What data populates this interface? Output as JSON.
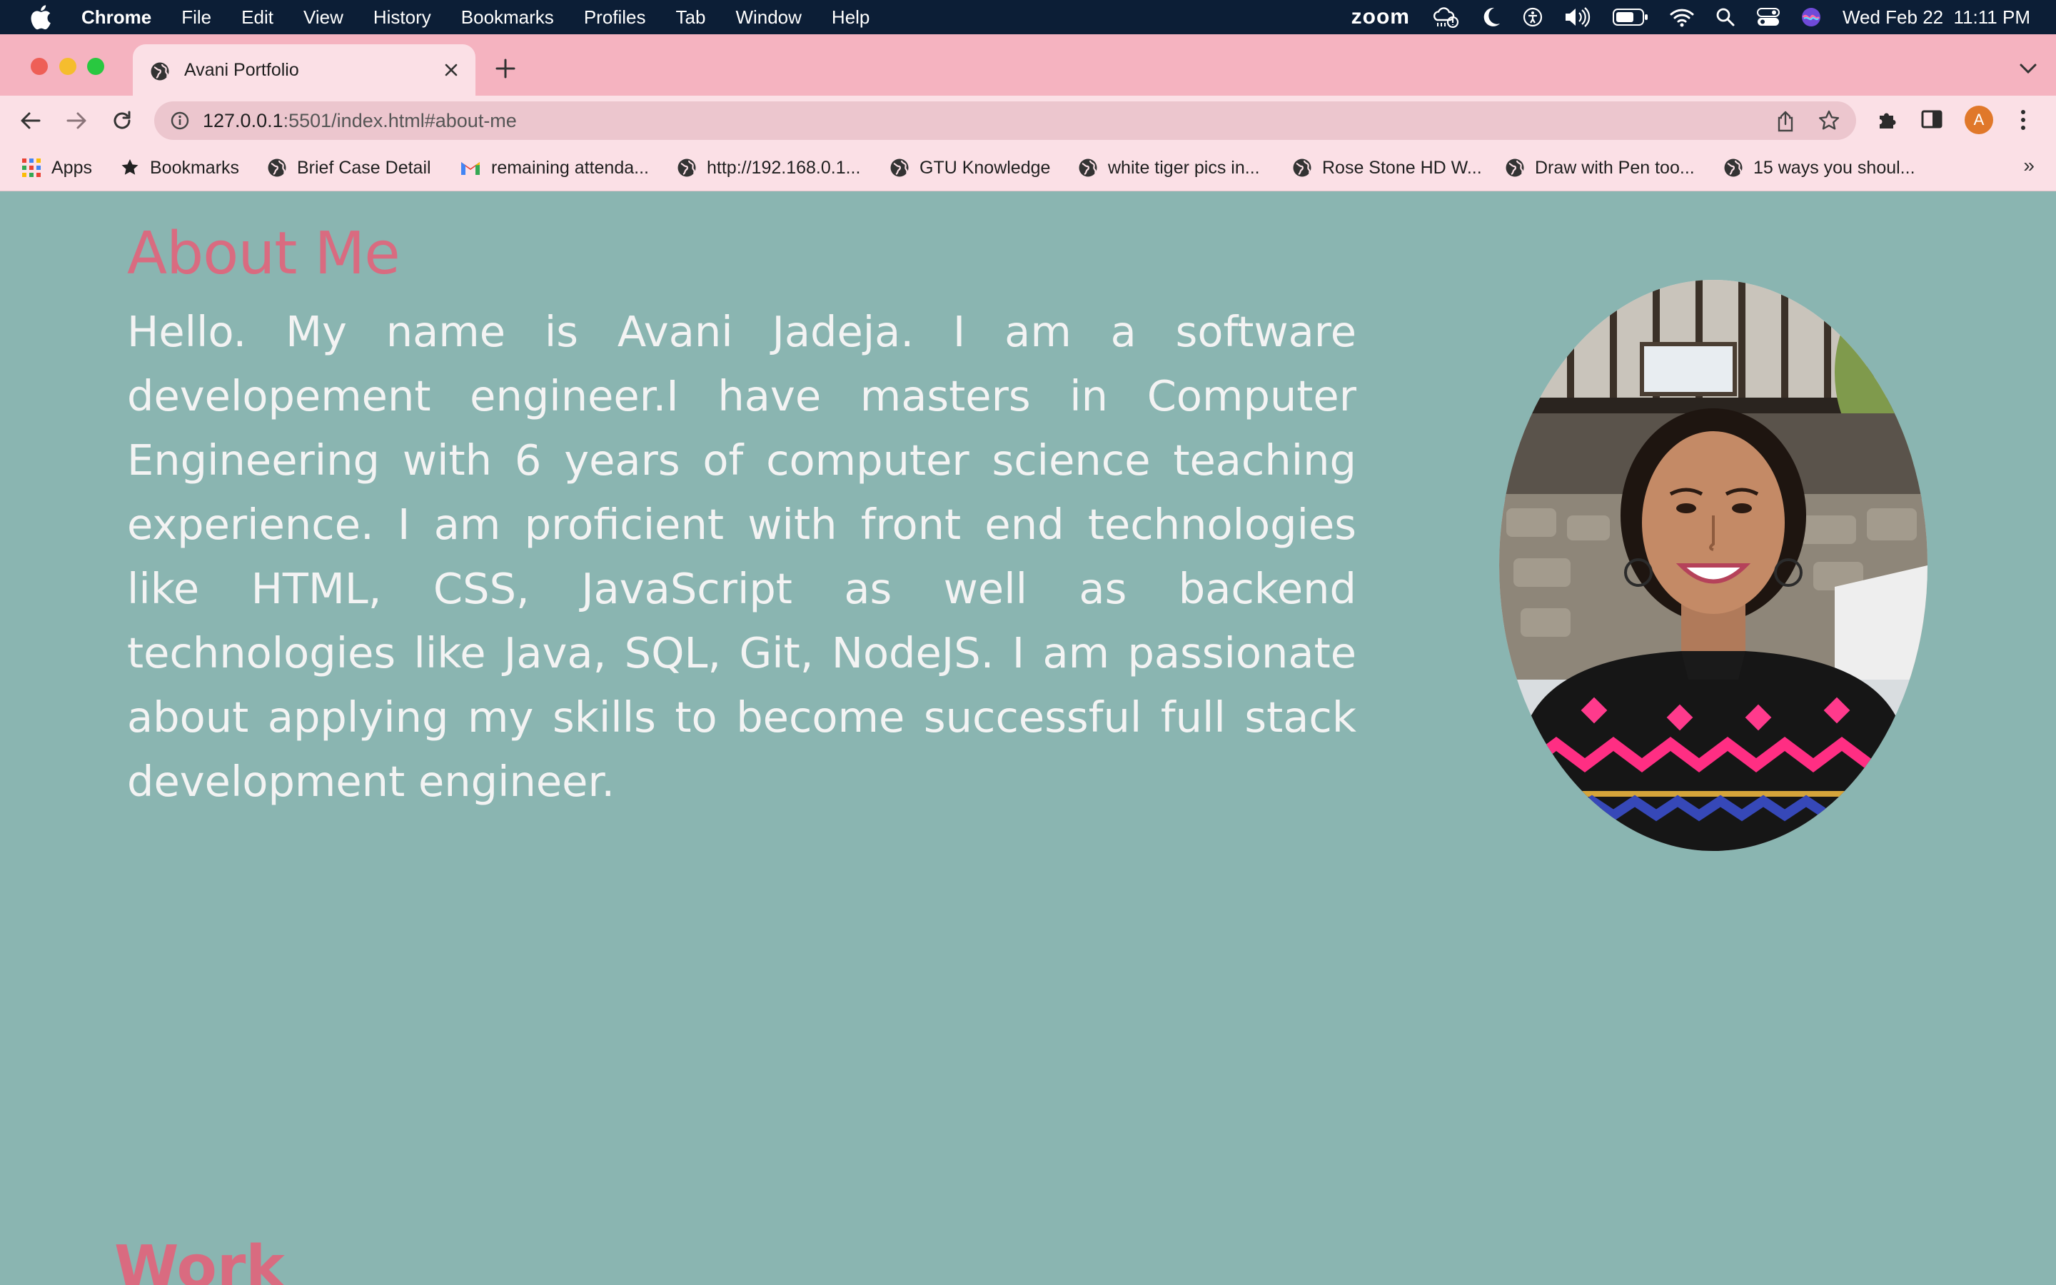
{
  "menubar": {
    "app_name": "Chrome",
    "menus": [
      "File",
      "Edit",
      "View",
      "History",
      "Bookmarks",
      "Profiles",
      "Tab",
      "Window",
      "Help"
    ],
    "zoom": "zoom",
    "datetime": "Wed Feb 22  11:11 PM"
  },
  "tab": {
    "title": "Avani Portfolio"
  },
  "omnibox": {
    "url_host": "127.0.0.1",
    "url_rest": ":5501/index.html#about-me"
  },
  "profile": {
    "initial": "A"
  },
  "bookmarks": {
    "apps": "Apps",
    "items": [
      "Bookmarks",
      "Brief Case Detail",
      "remaining attenda...",
      "http://192.168.0.1...",
      "GTU Knowledge",
      "white tiger pics in...",
      "Rose Stone HD W...",
      "Draw with Pen too...",
      "15 ways you shoul..."
    ],
    "more": "»"
  },
  "page": {
    "about_heading": "About Me",
    "about_text": "Hello. My name is Avani Jadeja. I am a software developement engineer.I have masters in Computer Engineering with 6 years of computer science teaching experience. I am proficient with front end technologies like HTML, CSS, JavaScript as well as backend technologies like Java, SQL, Git, NodeJS. I am passionate about applying my skills to become successful full stack development engineer.",
    "work_heading": "Work"
  },
  "colors": {
    "menubar_bg": "#0c1e36",
    "tabstrip_bg": "#f5b3c0",
    "toolbar_bg": "#fbe0e6",
    "page_bg": "#8ab5b1",
    "heading": "#d96b80",
    "body_text": "#f3f3f3"
  }
}
